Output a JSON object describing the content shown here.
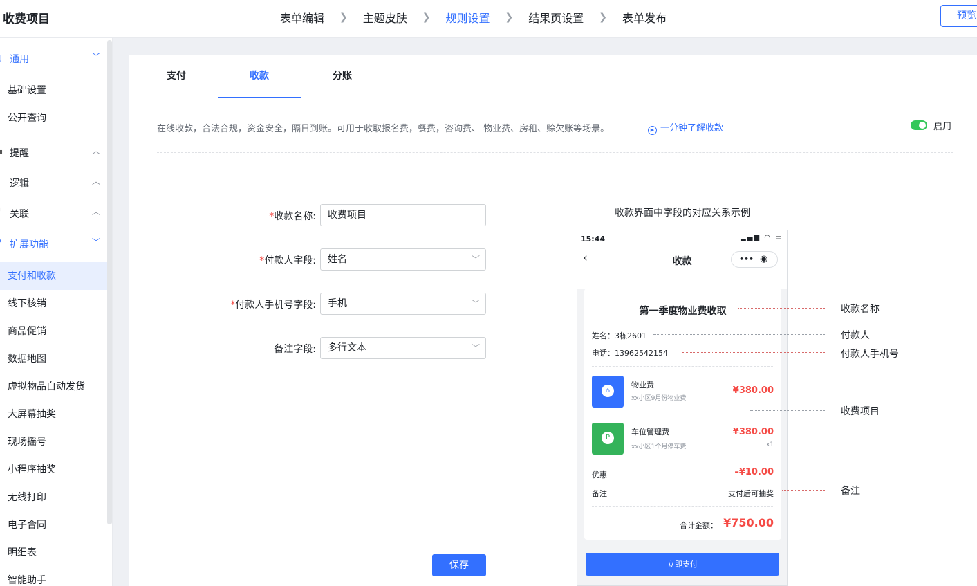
{
  "header": {
    "app_title": "收费项目",
    "steps": [
      {
        "label": "表单编辑"
      },
      {
        "label": "主题皮肤"
      },
      {
        "label": "规则设置"
      },
      {
        "label": "结果页设置"
      },
      {
        "label": "表单发布"
      }
    ],
    "active_step": "规则设置",
    "preview_label": "预览"
  },
  "sidebar": {
    "groups": {
      "general": "通用",
      "remind": "提醒",
      "logic": "逻辑",
      "relation": "关联",
      "extend": "扩展功能"
    },
    "general_items": [
      "基础设置",
      "公开查询"
    ],
    "extend_items": [
      "支付和收款",
      "线下核销",
      "商品促销",
      "数据地图",
      "虚拟物品自动发货",
      "大屏幕抽奖",
      "现场摇号",
      "小程序抽奖",
      "无线打印",
      "电子合同",
      "明细表",
      "智能助手"
    ],
    "active_item": "支付和收款"
  },
  "tabs": [
    "支付",
    "收款",
    "分账"
  ],
  "active_tab": "收款",
  "description": "在线收款，合法合规，资金安全，隔日到账。可用于收取报名费，餐费，咨询费、 物业费、房租、赊欠账等场景。",
  "learn_link": "一分钟了解收款",
  "enable_label": "启用",
  "enabled": true,
  "form": {
    "name_label": "收款名称:",
    "name_value": "收费项目",
    "payer_label": "付款人字段:",
    "payer_value": "姓名",
    "phone_label": "付款人手机号字段:",
    "phone_value": "手机",
    "remark_label": "备注字段:",
    "remark_value": "多行文本",
    "required_mark": "*",
    "save_label": "保存"
  },
  "example": {
    "title": "收款界面中字段的对应关系示例",
    "phone": {
      "time": "15:44",
      "header_title": "收款",
      "card_title": "第一季度物业费收取",
      "name_line": "姓名：3栋2601",
      "phone_line": "电话：13962542154",
      "items": [
        {
          "name": "物业费",
          "desc": "xx小区9月份物业费",
          "price": "¥380.00"
        },
        {
          "name": "车位管理费",
          "desc": "xx小区1个月停车费",
          "price": "¥380.00",
          "qty": "x1"
        }
      ],
      "discount_label": "优惠",
      "discount_value": "–¥10.00",
      "remark_label": "备注",
      "remark_value": "支付后可抽奖",
      "total_label": "合计金额：",
      "total_value": "¥750.00",
      "pay_button": "立即支付"
    },
    "annotations": [
      "收款名称",
      "付款人",
      "付款人手机号",
      "收费项目",
      "备注"
    ]
  },
  "colors": {
    "accent": "#3370ff",
    "danger": "#f54a45",
    "toggle_on": "#34c759",
    "product1": "#3370ff",
    "product2": "#34b35a"
  }
}
